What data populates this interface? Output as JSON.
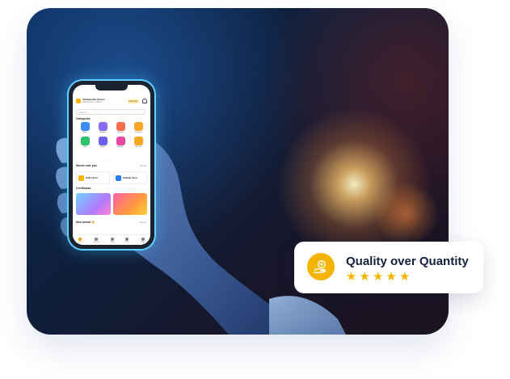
{
  "phone": {
    "header": {
      "store_name": "Abhinandan Stores",
      "store_sub": "Main Market, Ludhiana",
      "badge": "Edit Store"
    },
    "search_placeholder": "Search...",
    "categories_title": "Categories",
    "categories": [
      {
        "label": "Men",
        "color": "#3a8df5"
      },
      {
        "label": "Women",
        "color": "#8a6cf2"
      },
      {
        "label": "Watches",
        "color": "#f56d4a"
      },
      {
        "label": "Footwear",
        "color": "#f5a623"
      },
      {
        "label": "Toys",
        "color": "#2fc36b"
      },
      {
        "label": "Bags",
        "color": "#6a5ff0"
      },
      {
        "label": "Mobile",
        "color": "#e94aa3"
      },
      {
        "label": "Beauty",
        "color": "#f5a623"
      }
    ],
    "stores_title": "Stores near you",
    "stores_view_all": "View all",
    "stores": [
      {
        "name": "EI Nur Store",
        "color": "#f5b400"
      },
      {
        "name": "EI Marke Store",
        "color": "#2a7df5"
      }
    ],
    "certificates_title": "Certificates",
    "new_arrival_title": "New arrival",
    "new_arrival_view_all": "View all",
    "nav": [
      "Home",
      "Favourite",
      "Shop",
      "Orders",
      "Profile"
    ]
  },
  "card": {
    "title": "Quality over Quantity",
    "rating": 5,
    "accent": "#f5b400",
    "icon": "hand-holding-badge-icon"
  }
}
